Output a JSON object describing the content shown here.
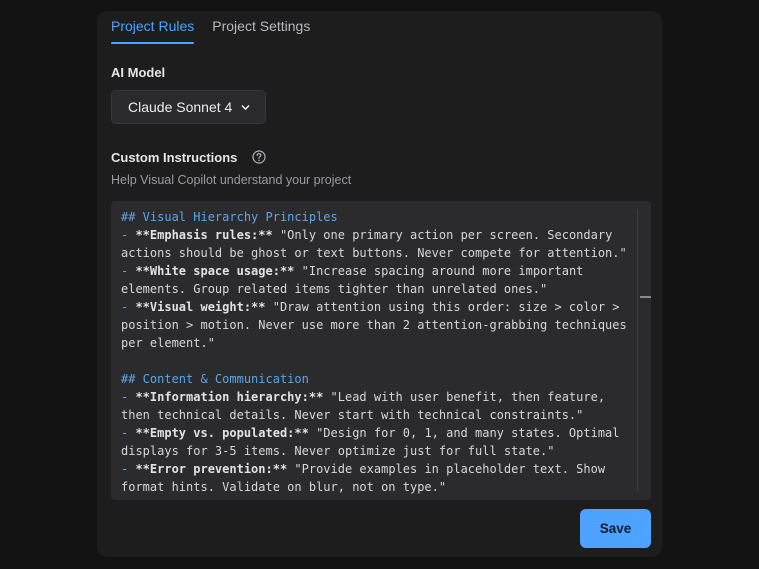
{
  "tabs": [
    {
      "label": "Project Rules",
      "active": true
    },
    {
      "label": "Project Settings",
      "active": false
    }
  ],
  "ai_model": {
    "label": "AI Model",
    "selected": "Claude Sonnet 4",
    "icon": "chevron-down-icon"
  },
  "custom_instructions": {
    "label": "Custom Instructions",
    "help_icon": "question-circle-icon",
    "helptext": "Help Visual Copilot understand your project",
    "lines": [
      [
        {
          "t": "## Visual Hierarchy Principles",
          "s": "h"
        }
      ],
      [
        {
          "t": "- ",
          "s": "d"
        },
        {
          "t": "**Emphasis rules:**",
          "s": "b"
        },
        {
          "t": " \"Only one primary action per screen. Secondary",
          "s": "n"
        }
      ],
      [
        {
          "t": "actions should be ghost or text buttons. Never compete for attention.\"",
          "s": "n"
        }
      ],
      [
        {
          "t": "- ",
          "s": "d"
        },
        {
          "t": "**White space usage:**",
          "s": "b"
        },
        {
          "t": " \"Increase spacing around more important",
          "s": "n"
        }
      ],
      [
        {
          "t": "elements. Group related items tighter than unrelated ones.\"",
          "s": "n"
        }
      ],
      [
        {
          "t": "- ",
          "s": "d"
        },
        {
          "t": "**Visual weight:**",
          "s": "b"
        },
        {
          "t": " \"Draw attention using this order: size > color >",
          "s": "n"
        }
      ],
      [
        {
          "t": "position > motion. Never use more than 2 attention-grabbing techniques",
          "s": "n"
        }
      ],
      [
        {
          "t": "per element.\"",
          "s": "n"
        }
      ],
      [
        {
          "t": "",
          "s": "n"
        }
      ],
      [
        {
          "t": "## Content & Communication",
          "s": "h"
        }
      ],
      [
        {
          "t": "- ",
          "s": "d"
        },
        {
          "t": "**Information hierarchy:**",
          "s": "b"
        },
        {
          "t": " \"Lead with user benefit, then feature,",
          "s": "n"
        }
      ],
      [
        {
          "t": "then technical details. Never start with technical constraints.\"",
          "s": "n"
        }
      ],
      [
        {
          "t": "- ",
          "s": "d"
        },
        {
          "t": "**Empty vs. populated:**",
          "s": "b"
        },
        {
          "t": " \"Design for 0, 1, and many states. Optimal",
          "s": "n"
        }
      ],
      [
        {
          "t": "displays for 3-5 items. Never optimize just for full state.\"",
          "s": "n"
        }
      ],
      [
        {
          "t": "- ",
          "s": "d"
        },
        {
          "t": "**Error prevention:**",
          "s": "b"
        },
        {
          "t": " \"Provide examples in placeholder text. Show",
          "s": "n"
        }
      ],
      [
        {
          "t": "format hints. Validate on blur, not on type.\"",
          "s": "n"
        }
      ]
    ]
  },
  "save_label": "Save",
  "colors": {
    "accent": "#4da3ff",
    "panel": "#1d1d1e",
    "background": "#131313"
  }
}
